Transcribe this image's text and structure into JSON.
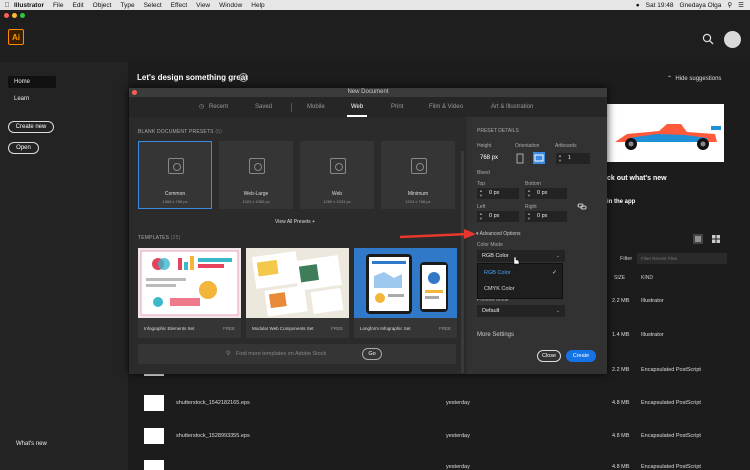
{
  "menubar": {
    "app": "Illustrator",
    "items": [
      "File",
      "Edit",
      "Object",
      "Type",
      "Select",
      "Effect",
      "View",
      "Window",
      "Help"
    ],
    "clock": "Sat 19:48",
    "user": "Gnedaya Olga"
  },
  "app": {
    "logo": "Ai",
    "accent": "#ff9a00"
  },
  "home": {
    "heading": "Let's design something great",
    "hide_suggestions": "Hide suggestions",
    "sidebar": {
      "home": "Home",
      "learn": "Learn",
      "create_new": "Create new",
      "open": "Open",
      "whats_new": "What's new"
    },
    "promo_title": "ck out what's new",
    "promo_link": "in the app",
    "filter_label": "Filter",
    "filter_placeholder": "Filter Recent Files",
    "col_size": "SIZE",
    "col_kind": "KIND",
    "files": [
      {
        "name": "",
        "date": "",
        "size": "2.2 MB",
        "kind": "Illustrator"
      },
      {
        "name": "",
        "date": "",
        "size": "1.4 MB",
        "kind": "Illustrator"
      },
      {
        "name": "",
        "date": "",
        "size": "2.2 MB",
        "kind": "Encapsulated PostScript"
      },
      {
        "name": "shutterstock_1542182165.eps",
        "date": "yesterday",
        "size": "4.8 MB",
        "kind": "Encapsulated PostScript"
      },
      {
        "name": "shutterstock_1528993355.eps",
        "date": "yesterday",
        "size": "4.8 MB",
        "kind": "Encapsulated PostScript"
      },
      {
        "name": "",
        "date": "yesterday",
        "size": "4.8 MB",
        "kind": "Encapsulated PostScript"
      }
    ]
  },
  "dialog": {
    "title": "New Document",
    "tabs": [
      "Recent",
      "Saved",
      "Mobile",
      "Web",
      "Print",
      "Film & Video",
      "Art & Illustration"
    ],
    "active_tab": "Web",
    "blank_presets_label": "BLANK DOCUMENT PRESETS",
    "blank_presets_count": "(5)",
    "presets": [
      {
        "name": "Common",
        "size": "1366 x 768 px"
      },
      {
        "name": "Web-Large",
        "size": "1920 x 1080 px"
      },
      {
        "name": "Web",
        "size": "1280 x 1024 px"
      },
      {
        "name": "Minimum",
        "size": "1024 x 768 px"
      }
    ],
    "view_all": "View All Presets",
    "templates_label": "TEMPLATES",
    "templates_count": "(25)",
    "templates": [
      {
        "name": "Infographic Elements Set",
        "price": "FREE"
      },
      {
        "name": "Modular Web Components Set",
        "price": "FREE"
      },
      {
        "name": "Longform Infographic Set",
        "price": "FREE"
      }
    ],
    "find_placeholder": "Find more templates on Adobe Stock",
    "go": "Go",
    "details": {
      "label": "PRESET DETAILS",
      "width_label": "Height",
      "width_value": "768 px",
      "orientation_label": "Orientation",
      "artboards_label": "Artboards",
      "artboards_value": "1",
      "bleed_label": "Bleed",
      "top_label": "Top",
      "top_value": "0 px",
      "bottom_label": "Bottom",
      "bottom_value": "0 px",
      "left_label": "Left",
      "left_value": "0 px",
      "right_label": "Right",
      "right_value": "0 px",
      "advanced_label": "Advanced Options",
      "color_mode_label": "Color Mode",
      "color_mode_value": "RGB Color",
      "color_options": [
        "RGB Color",
        "CMYK Color"
      ],
      "preview_label": "Preview Mode",
      "preview_value": "Default",
      "more_settings": "More Settings"
    },
    "close": "Close",
    "create": "Create"
  }
}
